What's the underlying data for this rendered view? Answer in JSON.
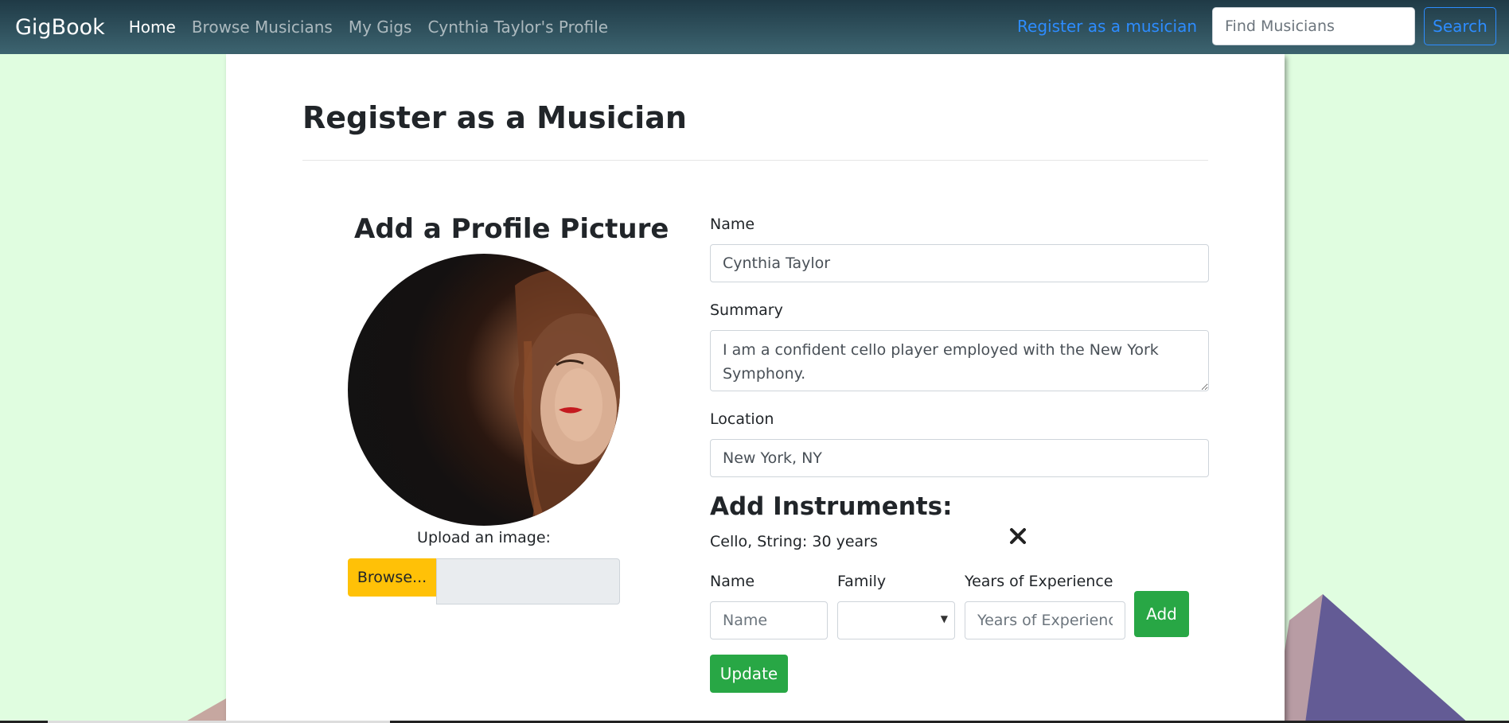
{
  "navbar": {
    "brand": "GigBook",
    "links": [
      "Home",
      "Browse Musicians",
      "My Gigs",
      "Cynthia Taylor's Profile"
    ],
    "register_link": "Register as a musician",
    "search_placeholder": "Find Musicians",
    "search_button": "Search"
  },
  "page": {
    "title": "Register as a Musician"
  },
  "profile_picture": {
    "title": "Add a Profile Picture",
    "upload_label": "Upload an image:",
    "browse_button": "Browse..."
  },
  "form": {
    "name_label": "Name",
    "name_value": "Cynthia Taylor",
    "summary_label": "Summary",
    "summary_value": "I am a confident cello player employed with the New York Symphony.",
    "location_label": "Location",
    "location_value": "New York, NY"
  },
  "instruments": {
    "title": "Add Instruments:",
    "items": [
      "Cello, String: 30 years"
    ],
    "new_name_label": "Name",
    "new_name_placeholder": "Name",
    "new_family_label": "Family",
    "new_family_value": "",
    "new_years_label": "Years of Experience",
    "new_years_placeholder": "Years of Experience",
    "add_button": "Add",
    "update_button": "Update"
  },
  "colors": {
    "background": "#e0fde0",
    "primary": "#2d8cff",
    "success": "#28a745",
    "warning": "#ffc107"
  }
}
